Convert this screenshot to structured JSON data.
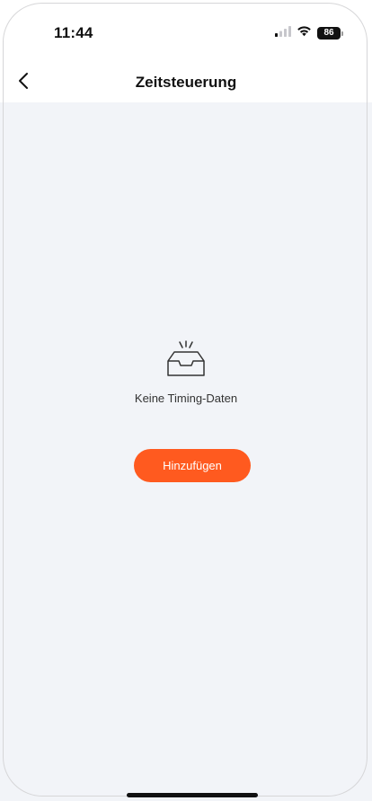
{
  "status_bar": {
    "time": "11:44",
    "battery_level": "86",
    "icons": [
      "signal-icon",
      "wifi-icon",
      "battery-icon"
    ]
  },
  "nav": {
    "title": "Zeitsteuerung",
    "back_icon": "chevron-left-icon"
  },
  "empty_state": {
    "icon": "empty-inbox-icon",
    "message": "Keine Timing-Daten"
  },
  "actions": {
    "add_label": "Hinzufügen"
  },
  "colors": {
    "accent": "#ff5a1f",
    "content_background": "#f2f4f8",
    "text_primary": "#111111",
    "text_secondary": "#333333"
  }
}
